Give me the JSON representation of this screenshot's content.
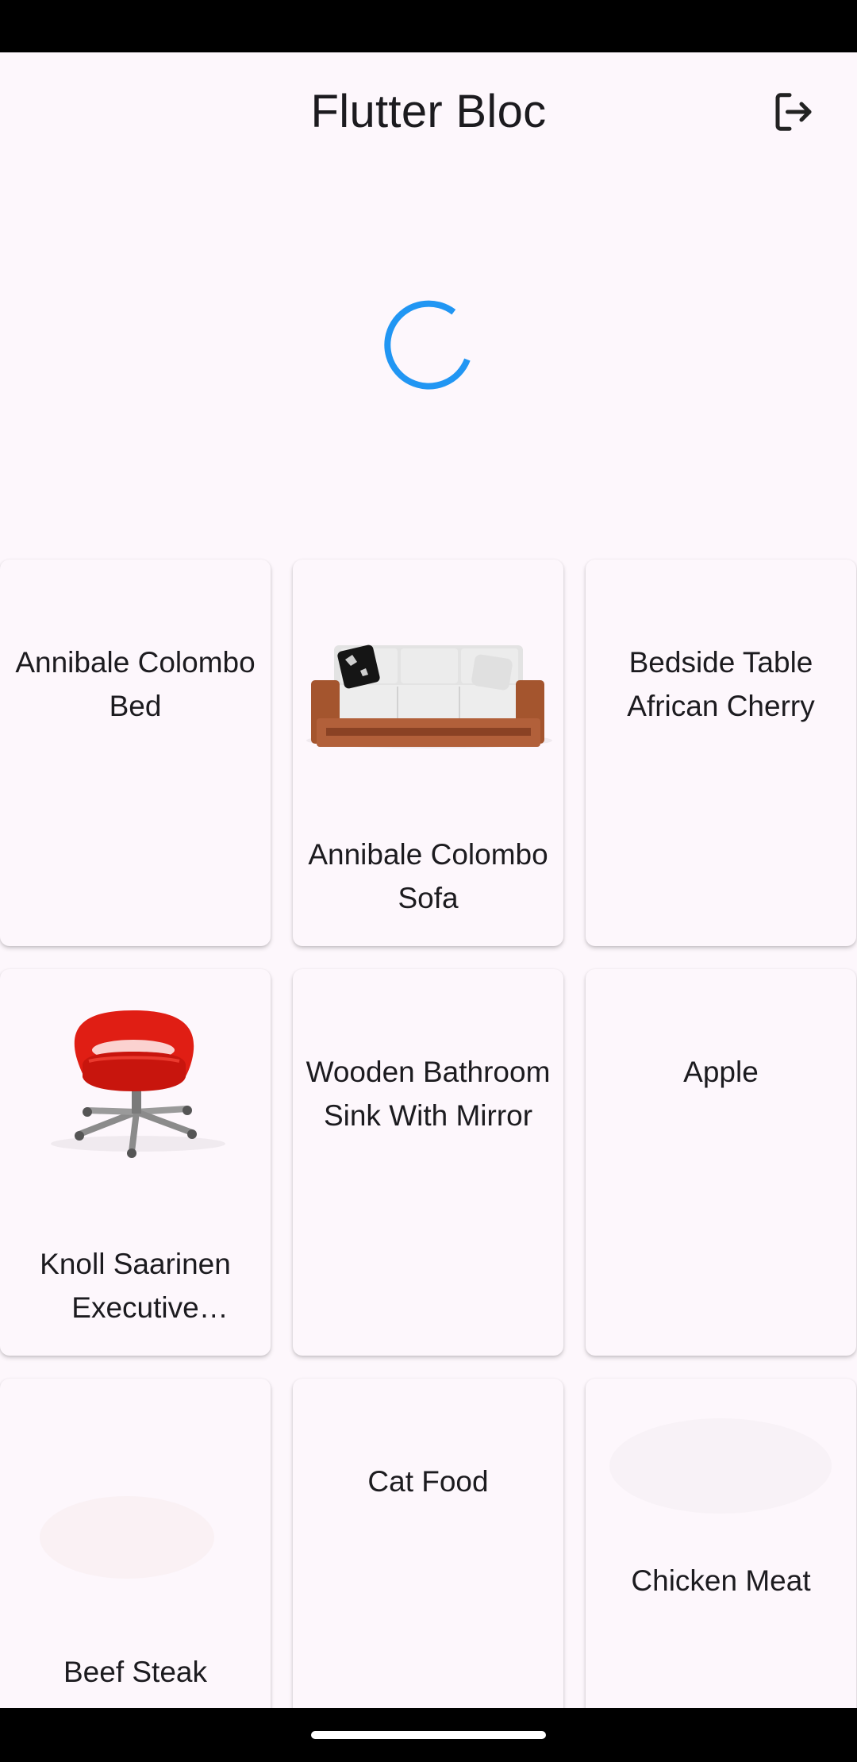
{
  "app_bar": {
    "title": "Flutter Bloc",
    "logout_icon": "logout-icon"
  },
  "loading": {
    "indicator": "circular-progress",
    "color": "#2196f3"
  },
  "products": [
    {
      "name": "Annibale Colombo Bed",
      "image": "none"
    },
    {
      "name": "Annibale Colombo Sofa",
      "image": "sofa"
    },
    {
      "name": "Bedside Table African Cherry",
      "image": "none"
    },
    {
      "name": "Knoll Saarinen Executive Conference Chair",
      "image": "red-chair"
    },
    {
      "name": "Wooden Bathroom Sink With Mirror",
      "image": "none"
    },
    {
      "name": "Apple",
      "image": "none"
    },
    {
      "name": "Beef Steak",
      "image": "faint"
    },
    {
      "name": "Cat Food",
      "image": "none"
    },
    {
      "name": "Chicken Meat",
      "image": "faint"
    }
  ]
}
